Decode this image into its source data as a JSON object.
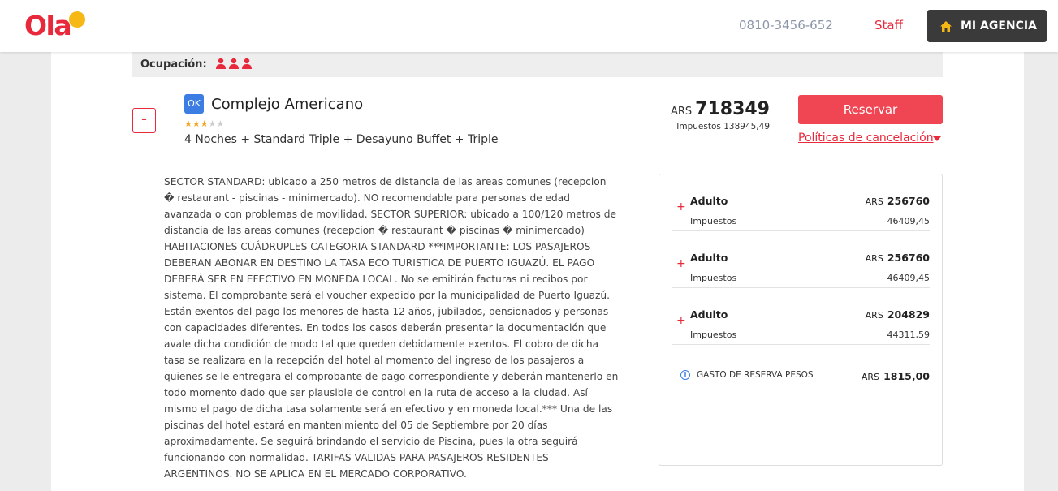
{
  "header": {
    "logo_text": "Ola",
    "phone": "0810-3456-652",
    "staff_label": "Staff",
    "agency_label": "MI AGENCIA"
  },
  "occupancy": {
    "label": "Ocupación:",
    "passengers": 3
  },
  "hotel": {
    "collapse_symbol": "–",
    "badge": "OK",
    "name": "Complejo Americano",
    "rating": 3,
    "max_rating": 5,
    "room_description": "4 Noches + Standard Triple + Desayuno Buffet + Triple"
  },
  "price": {
    "currency": "ARS",
    "total": "718349",
    "taxes_label": "Impuestos",
    "taxes_value": "138945,49"
  },
  "actions": {
    "reserve_label": "Reservar",
    "cancel_policy_label": "Políticas de cancelación"
  },
  "policy_text": "SECTOR STANDARD: ubicado a 250 metros de distancia de las areas comunes (recepcion � restaurant - piscinas - minimercado). NO recomendable para personas de edad avanzada o con problemas de movilidad. SECTOR SUPERIOR: ubicado a 100/120 metros de distancia de las areas comunes (recepcion � restaurant � piscinas � minimercado) HABITACIONES CUÁDRUPLES CATEGORIA STANDARD ***IMPORTANTE: LOS PASAJEROS DEBERAN ABONAR EN DESTINO LA TASA ECO TURISTICA DE PUERTO IGUAZÚ. EL PAGO DEBERÁ SER EN EFECTIVO EN MONEDA LOCAL. No se emitirán facturas ni recibos por sistema. El comprobante será el voucher expedido por la municipalidad de Puerto Iguazú. Están exentos del pago los menores de hasta 12 años, jubilados, pensionados y personas con capacidades diferentes. En todos los casos deberán presentar la documentación que avale dicha condición de modo tal que queden debidamente exentos. El cobro de dicha tasa se realizara en la recepción del hotel al momento del ingreso de los pasajeros a quienes se le entregara el comprobante de pago correspondiente y deberán mantenerlo en todo momento dado que ser plausible de control en la ruta de acceso a la ciudad. Así mismo el pago de dicha tasa solamente será en efectivo y en moneda local.*** Una de las piscinas del hotel estará en mantenimiento del 05 de Septiembre por 20 días aproximadamente. Se seguirá brindando el servicio de Piscina, pues la otra seguirá funcionando con normalidad. TARIFAS VALIDAS PARA PASAJEROS RESIDENTES ARGENTINOS. NO SE APLICA EN EL MERCADO CORPORATIVO.",
  "breakdown": {
    "rows": [
      {
        "plus": "+",
        "label": "Adulto",
        "currency": "ARS",
        "amount": "256760",
        "tax_label": "Impuestos",
        "tax_value": "46409,45"
      },
      {
        "plus": "+",
        "label": "Adulto",
        "currency": "ARS",
        "amount": "256760",
        "tax_label": "Impuestos",
        "tax_value": "46409,45"
      },
      {
        "plus": "+",
        "label": "Adulto",
        "currency": "ARS",
        "amount": "204829",
        "tax_label": "Impuestos",
        "tax_value": "44311,59"
      }
    ],
    "fee": {
      "label": "GASTO DE RESERVA PESOS",
      "currency": "ARS",
      "amount": "1815,00"
    }
  },
  "colors": {
    "brand_red": "#e8293b",
    "brand_yellow": "#f6b814",
    "reserve_button": "#f04552",
    "ok_badge": "#3b7de3",
    "agency_button": "#3a3a3a"
  }
}
